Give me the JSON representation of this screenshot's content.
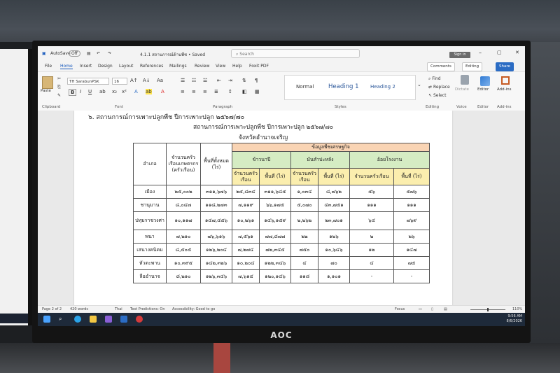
{
  "titlebar": {
    "autosave": "AutoSave",
    "autosave_state": "Off",
    "doc_name": "4.1.1 สถานการณ์ด้านพืช • Saved",
    "search_placeholder": "Search",
    "signin": "Sign in"
  },
  "menu": {
    "tabs": [
      "File",
      "Home",
      "Insert",
      "Design",
      "Layout",
      "References",
      "Mailings",
      "Review",
      "View",
      "Help",
      "Foxit PDF"
    ],
    "comments": "Comments",
    "editing": "Editing",
    "share": "Share"
  },
  "ribbon": {
    "paste": "Paste",
    "font_name": "TH SarabunPSK",
    "font_size": "16",
    "styles": [
      "Normal",
      "Heading 1",
      "Heading 2"
    ],
    "find": "Find",
    "replace": "Replace",
    "select": "Select",
    "dictate": "Dictate",
    "editor": "Editor",
    "addins": "Add-ins",
    "groups": [
      "Clipboard",
      "Font",
      "Paragraph",
      "Styles",
      "Editing",
      "Voice",
      "Editor",
      "Add-ins"
    ]
  },
  "document": {
    "heading": "๖. สถานการณ์การเพาะปลูกพืช ปีการเพาะปลูก ๒๕๖๗/๗๐",
    "subtitle": "สถานการณ์การเพาะปลูกพืช ปีการเพาะปลูก ๒๕๖๗/๗๐",
    "province": "จังหวัดอำนาจเจริญ",
    "table": {
      "col_district": "อำเภอ",
      "col_households": "จำนวนครัวเรือนเกษตรกร",
      "col_households_unit": "(ครัวเรือน)",
      "col_area": "พื้นที่ทั้งหมด",
      "col_area_unit": "(ไร่)",
      "econ_header": "ข้อมูลพืชเศรษฐกิจ",
      "crops": [
        "ข้าวนาปี",
        "มันสำปะหลัง",
        "อ้อยโรงงาน"
      ],
      "sub_households": "จำนวนครัวเรือน",
      "sub_area": "พื้นที่ (ไร่)",
      "rows": [
        [
          "เมือง",
          "๒๕,๐๐๒",
          "๓๑๑,๖๗๖",
          "๒๕,๘๓๔",
          "๓๑๑,๖๘๕",
          "๑,๐๓๔",
          "๘,๗๖๒",
          "๕๖",
          "๕๗๖"
        ],
        [
          "ชานุมาน",
          "๘,๐๔๗",
          "๑๑๘,๒๗๓",
          "๗,๑๑๙",
          "๖๖,๑๗๕",
          "๕,๐๗๐",
          "๔๓,๗๕๑",
          "๑๑๑",
          "๑๑๑"
        ],
        [
          "ปทุมราชวงศา",
          "๑๐,๑๑๗",
          "๑๔๗,๔๕๖",
          "๑๐,๒๖๑",
          "๑๔๖,๑๕๙",
          "๒,๒๖๒",
          "๒๓,๗๐๑",
          "๖๔",
          "๗๖๙"
        ],
        [
          "พนา",
          "๗,๒๑๐",
          "๗๖,๖๑๖",
          "๗,๕๖๑",
          "๗๗,๘๗๗",
          "๒๒",
          "๑๒๖",
          "๒",
          "๒๖"
        ],
        [
          "เสนางคนิคม",
          "๘,๕๐๕",
          "๑๒๖,๒๐๔",
          "๗,๒๗๔",
          "๗๒,๓๔๕",
          "๗๕๐",
          "๑๐,๖๔๖",
          "๑๒",
          "๑๔๗"
        ],
        [
          "หัวตะพาน",
          "๑๐,๓๙๕",
          "๑๔๒,๓๒๖",
          "๑๐,๒๐๔",
          "๑๒๒,๓๔๖",
          "๔",
          "๗๐",
          "๔",
          "๗๕"
        ],
        [
          "ลืออำนาจ",
          "๘,๒๑๐",
          "๑๒๖,๓๔๖",
          "๗,๖๑๔",
          "๑๒๐,๑๔๖",
          "๑๑๘",
          "๑,๑๐๑",
          "-",
          "-"
        ]
      ]
    }
  },
  "statusbar": {
    "page": "Page 2 of 2",
    "words": "420 words",
    "lang": "Thai",
    "predictions": "Text Predictions: On",
    "accessibility": "Accessibility: Good to go",
    "focus": "Focus",
    "zoom": "110%"
  },
  "taskbar": {
    "time": "9:56 AM",
    "date": "8/6/2026"
  },
  "monitor_brand": "AOC",
  "colors": {
    "accent": "#185abd",
    "header_orange": "#f9d4b4",
    "header_green": "#d5ecc3",
    "header_yellow": "#fbeeae"
  }
}
